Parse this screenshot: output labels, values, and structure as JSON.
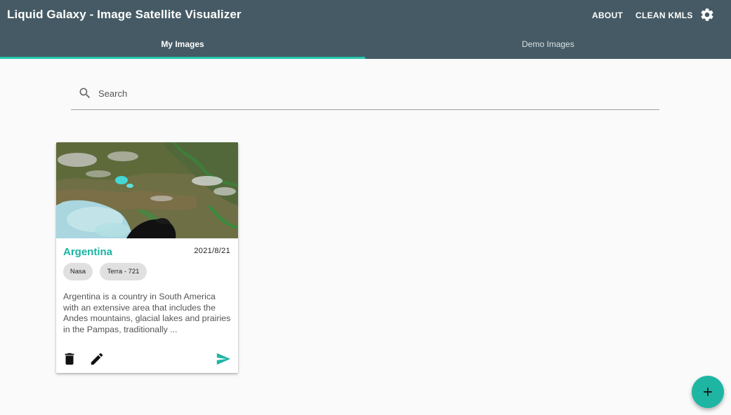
{
  "app": {
    "title": "Liquid Galaxy - Image Satellite Visualizer",
    "about_label": "ABOUT",
    "clean_label": "CLEAN KMLS",
    "settings_icon": "gear-icon"
  },
  "tabs": [
    {
      "label": "My Images",
      "active": true
    },
    {
      "label": "Demo Images",
      "active": false
    }
  ],
  "search": {
    "placeholder": "Search",
    "value": "",
    "icon": "search-icon"
  },
  "cards": [
    {
      "title": "Argentina",
      "date": "2021/8/21",
      "chips": [
        "Nasa",
        "Terra - 721"
      ],
      "description": "Argentina is a country in South America with an extensive area that includes the Andes mountains, glacial lakes and prairies in the Pampas, traditionally ...",
      "actions": [
        "trash-icon",
        "pencil-icon",
        "send-icon"
      ]
    }
  ],
  "fab": {
    "icon": "plus-icon"
  },
  "colors": {
    "appbar": "#455a64",
    "accent": "#1fb5a3",
    "tab_indicator": "#26c6b0",
    "background": "#fafafa"
  }
}
